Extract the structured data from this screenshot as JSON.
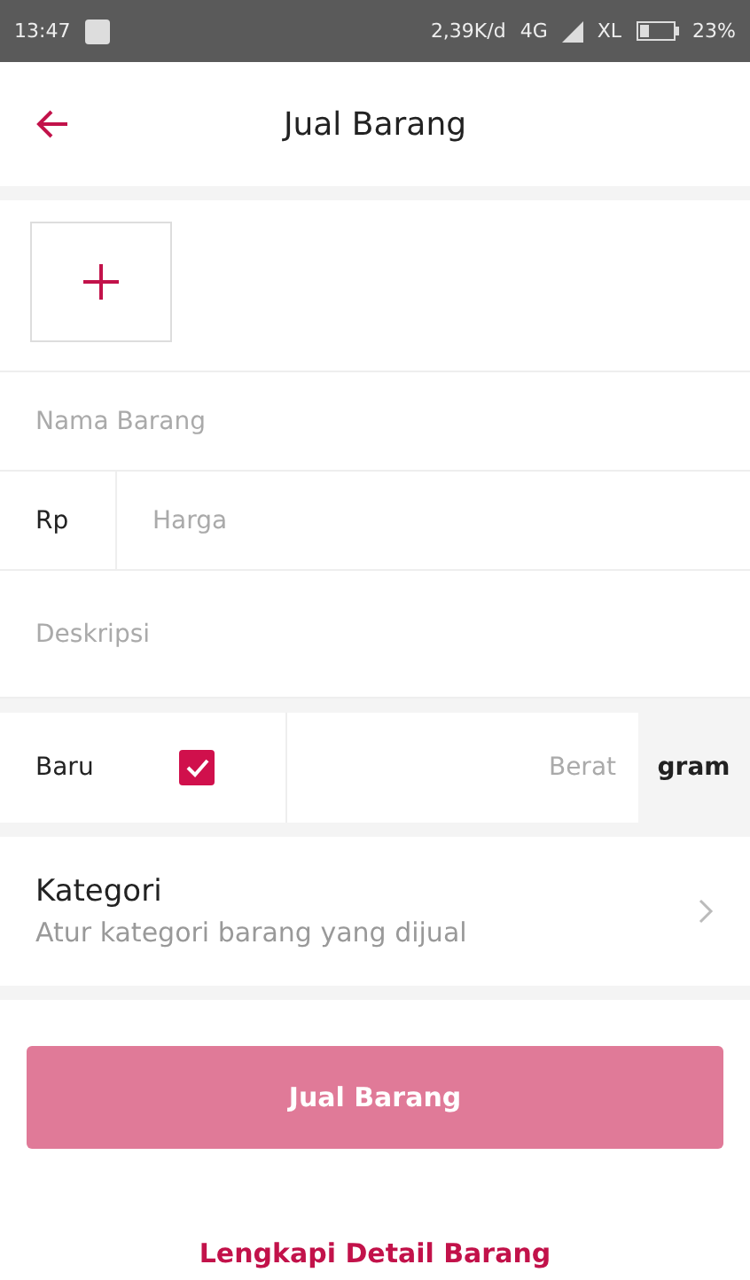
{
  "status_bar": {
    "time": "13:47",
    "speed": "2,39K/d",
    "network": "4G",
    "carrier": "XL",
    "battery": "23%"
  },
  "header": {
    "title": "Jual Barang"
  },
  "fields": {
    "name": {
      "placeholder": "Nama Barang"
    },
    "price": {
      "prefix": "Rp",
      "placeholder": "Harga"
    },
    "description": {
      "placeholder": "Deskripsi"
    }
  },
  "condition": {
    "label": "Baru",
    "checked": true
  },
  "weight": {
    "placeholder": "Berat",
    "unit": "gram"
  },
  "category": {
    "title": "Kategori",
    "subtitle": "Atur kategori barang yang dijual"
  },
  "submit": {
    "label": "Jual Barang",
    "disabled": true
  },
  "link": "Lengkapi Detail Barang"
}
